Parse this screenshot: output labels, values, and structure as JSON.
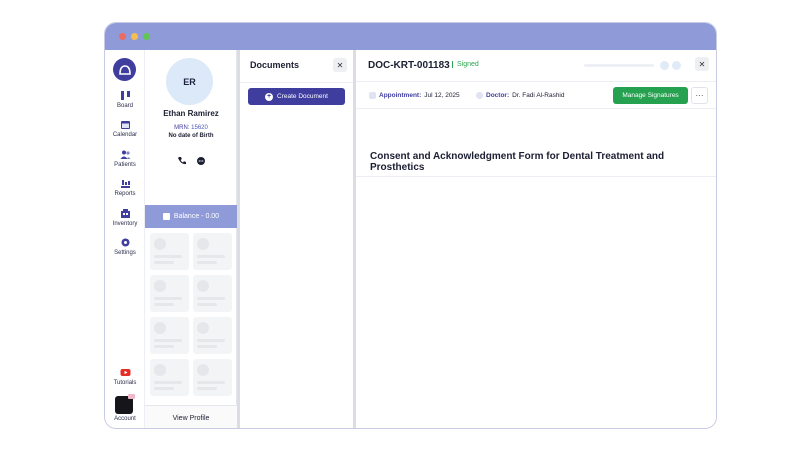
{
  "nav": {
    "items": [
      {
        "label": "Board",
        "icon": "board-icon"
      },
      {
        "label": "Calendar",
        "icon": "calendar-icon"
      },
      {
        "label": "Patients",
        "icon": "patients-icon",
        "active": true
      },
      {
        "label": "Reports",
        "icon": "reports-icon"
      },
      {
        "label": "Inventory",
        "icon": "inventory-icon"
      },
      {
        "label": "Settings",
        "icon": "gear-icon"
      }
    ],
    "tutorials": "Tutorials",
    "account": "Account"
  },
  "patient": {
    "initials": "ER",
    "name": "Ethan Ramirez",
    "mrn_label": "MRN:",
    "mrn_value": "15620",
    "dob": "No date of Birth",
    "balance": "Balance - 0.00",
    "view_profile": "View Profile"
  },
  "documents": {
    "title": "Documents",
    "create_label": "Create Document"
  },
  "document": {
    "id": "DOC-KRT-001183",
    "status": "Signed",
    "appointment_label": "Appointment:",
    "appointment_value": "Jul 12, 2025",
    "doctor_label": "Doctor:",
    "doctor_value": "Dr. Fadi Al-Rashid",
    "manage_label": "Manage Signatures",
    "more_label": "···",
    "form_title": "Consent and Acknowledgment Form for Dental Treatment and Prosthetics"
  },
  "colors": {
    "accent": "#3f3d9e",
    "titlebar": "#8f9bd9",
    "success": "#25a150"
  }
}
